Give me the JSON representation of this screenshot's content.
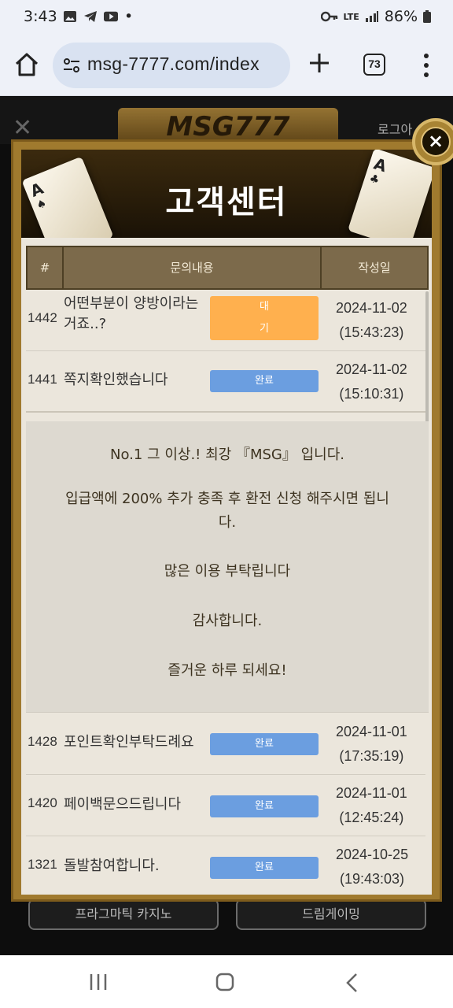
{
  "status_bar": {
    "time": "3:43",
    "dot": "•",
    "lte": "LTE",
    "battery": "86%",
    "icons": [
      "image-icon",
      "telegram-icon",
      "youtube-icon",
      "key-icon",
      "signal-icon",
      "battery-icon"
    ]
  },
  "browser": {
    "url": "msg-7777.com/index",
    "tab_count": "73"
  },
  "background_page": {
    "logo": "MSG777",
    "login": "로그아",
    "tiles": [
      "프라그마틱 카지노",
      "드림게이밍"
    ]
  },
  "modal": {
    "title": "고객센터",
    "close_glyph": "×",
    "columns": {
      "num": "#",
      "content": "문의내용",
      "date": "작성일"
    },
    "rows": [
      {
        "num": "1442",
        "subject_line1": "어떤부분이 양방이라는",
        "subject_line2": "거죠..?",
        "status": "대",
        "status2": "기",
        "date": "2024-11-02",
        "time": "(15:43:23)"
      },
      {
        "num": "1441",
        "subject_line1": "쪽지확인했습니다",
        "status": "완료",
        "date": "2024-11-02",
        "time": "(15:10:31)"
      },
      {
        "num": "1428",
        "subject_line1": "포인트확인부탁드례요",
        "status": "완료",
        "date": "2024-11-01",
        "time": "(17:35:19)"
      },
      {
        "num": "1420",
        "subject_line1": "페이백문으드립니다",
        "status": "완료",
        "date": "2024-11-01",
        "time": "(12:45:24)"
      },
      {
        "num": "1321",
        "subject_line1": "돌발참여합니다.",
        "status": "완료",
        "date": "2024-10-25",
        "time": "(19:43:03)"
      }
    ],
    "answer": {
      "line1": "No.1 그 이상.! 최강 『MSG』 입니다.",
      "line2a": "입급액에 200% 추가 충족 후 환전 신청 해주시면 됩니",
      "line2b": "다.",
      "line3": "많은 이용 부탁립니다",
      "line4": "감사합니다.",
      "line5": "즐거운 하루 되세요!"
    }
  },
  "colors": {
    "gold": "#a07a2e",
    "header_brown": "#7c6a4b",
    "status_done": "#6b9ee0",
    "status_wait": "#ffb04e"
  }
}
